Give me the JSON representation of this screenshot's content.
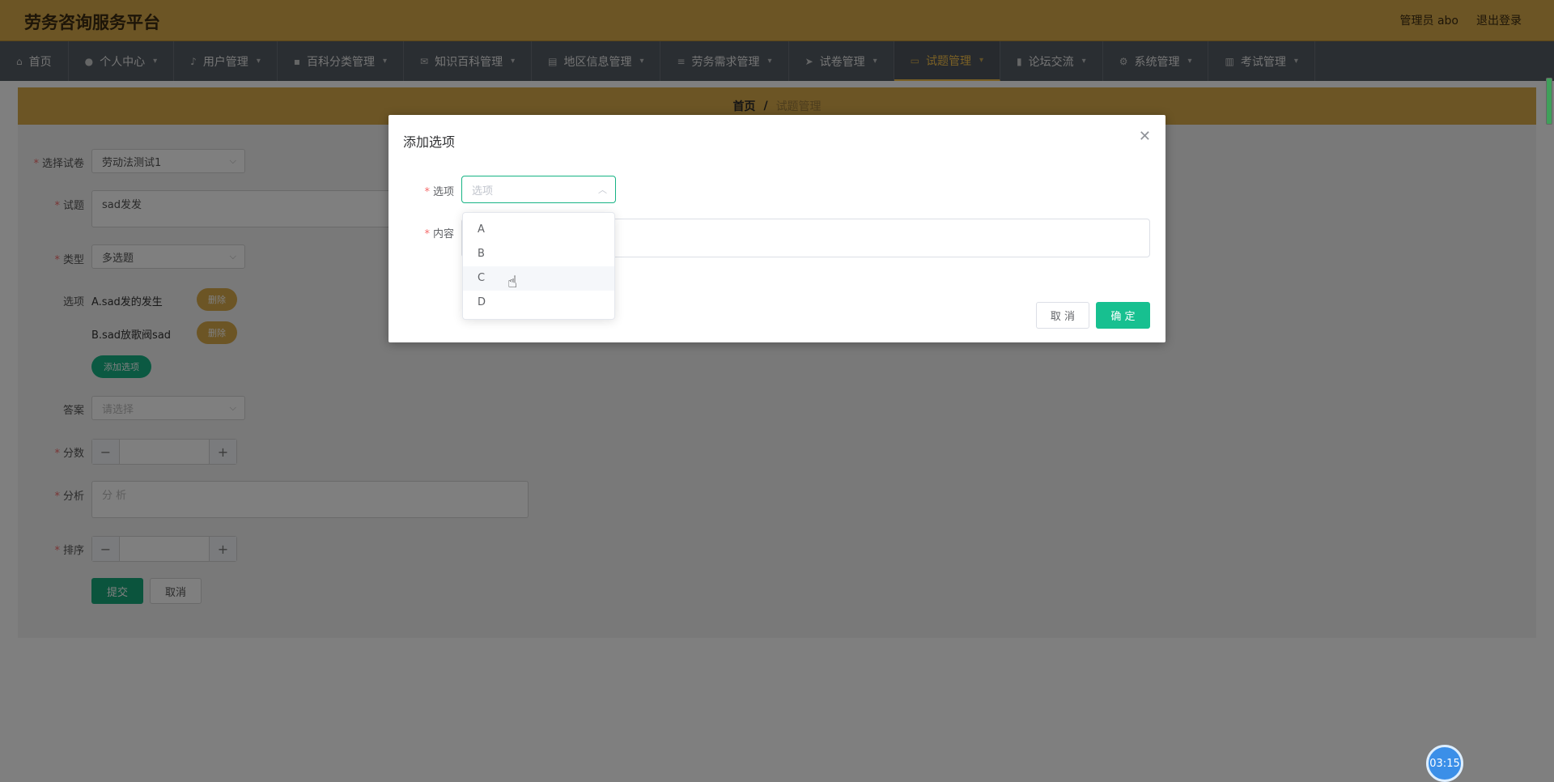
{
  "header": {
    "app_title": "劳务咨询服务平台",
    "user_label": "管理员 abo",
    "logout_label": "退出登录"
  },
  "nav": {
    "items": [
      {
        "label": "首页",
        "icon": "home-icon"
      },
      {
        "label": "个人中心",
        "icon": "user-icon"
      },
      {
        "label": "用户管理",
        "icon": "mic-icon"
      },
      {
        "label": "百科分类管理",
        "icon": "folder-icon"
      },
      {
        "label": "知识百科管理",
        "icon": "mail-icon"
      },
      {
        "label": "地区信息管理",
        "icon": "building-icon"
      },
      {
        "label": "劳务需求管理",
        "icon": "list-icon"
      },
      {
        "label": "试卷管理",
        "icon": "send-icon"
      },
      {
        "label": "试题管理",
        "icon": "ticket-icon"
      },
      {
        "label": "论坛交流",
        "icon": "clipboard-icon"
      },
      {
        "label": "系统管理",
        "icon": "gear-icon"
      },
      {
        "label": "考试管理",
        "icon": "chart-icon"
      }
    ],
    "active_index": 8
  },
  "breadcrumb": {
    "home": "首页",
    "separator": "/",
    "current": "试题管理"
  },
  "form": {
    "paper_label": "选择试卷",
    "paper_value": "劳动法测试1",
    "question_label": "试题",
    "question_value": "sad发发",
    "type_label": "类型",
    "type_value": "多选题",
    "options_label": "选项",
    "options": [
      {
        "text": "A.sad发的发生",
        "delete_label": "删除"
      },
      {
        "text": "B.sad放歌阀sad",
        "delete_label": "删除"
      }
    ],
    "add_option_label": "添加选项",
    "answer_label": "答案",
    "answer_placeholder": "请选择",
    "score_label": "分数",
    "analysis_label": "分析",
    "analysis_placeholder": "分 析",
    "sort_label": "排序",
    "submit_label": "提交",
    "cancel_label": "取消"
  },
  "dialog": {
    "title": "添加选项",
    "option_label": "选项",
    "option_placeholder": "选项",
    "content_label": "内容",
    "cancel_label": "取 消",
    "confirm_label": "确 定",
    "dropdown_items": [
      "A",
      "B",
      "C",
      "D"
    ],
    "hover_index": 2
  },
  "timer": {
    "value": "03:15"
  },
  "colors": {
    "header_bg": "#d8aa4b",
    "nav_bg": "#545c64",
    "accent_green": "#17c090",
    "active_nav": "#f5c04a"
  }
}
